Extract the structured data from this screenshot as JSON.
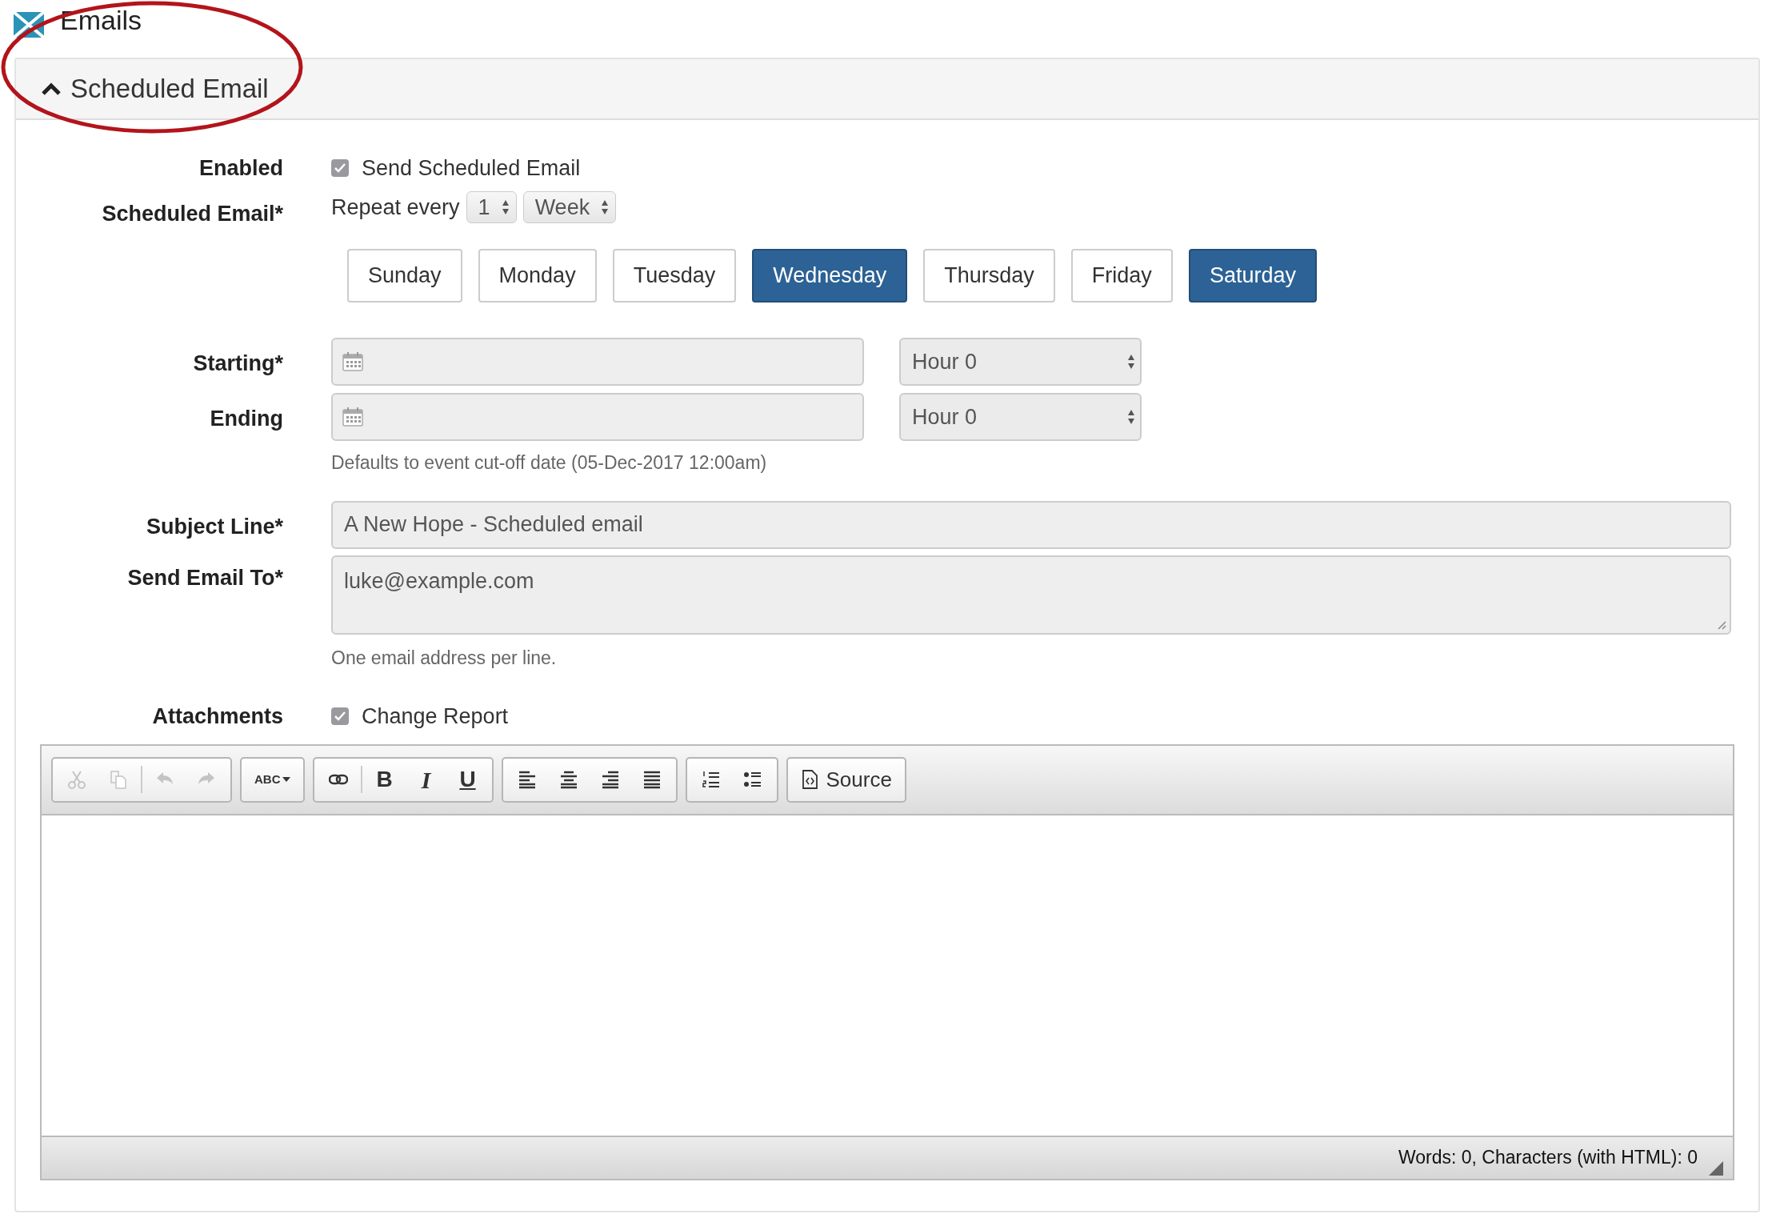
{
  "page": {
    "title": "Emails"
  },
  "panel": {
    "title": "Scheduled Email",
    "expanded": true
  },
  "enabled": {
    "label": "Enabled",
    "option": "Send Scheduled Email",
    "checked": true
  },
  "schedule": {
    "label": "Scheduled Email*",
    "prefix": "Repeat every",
    "interval": "1",
    "unit": "Week",
    "days": [
      {
        "label": "Sunday",
        "selected": false
      },
      {
        "label": "Monday",
        "selected": false
      },
      {
        "label": "Tuesday",
        "selected": false
      },
      {
        "label": "Wednesday",
        "selected": true
      },
      {
        "label": "Thursday",
        "selected": false
      },
      {
        "label": "Friday",
        "selected": false
      },
      {
        "label": "Saturday",
        "selected": true
      }
    ]
  },
  "starting": {
    "label": "Starting*",
    "hour": "Hour 0"
  },
  "ending": {
    "label": "Ending",
    "hour": "Hour 0",
    "help": "Defaults to event cut-off date (05-Dec-2017 12:00am)"
  },
  "subject": {
    "label": "Subject Line*",
    "value": "A New Hope - Scheduled email"
  },
  "send_to": {
    "label": "Send Email To*",
    "value": "luke@example.com",
    "help": "One email address per line."
  },
  "attachments": {
    "label": "Attachments",
    "option": "Change Report",
    "checked": true
  },
  "editor": {
    "toolbar": [
      [
        {
          "kind": "cut",
          "disabled": true
        },
        {
          "kind": "copy",
          "disabled": true
        },
        {
          "kind": "sep"
        },
        {
          "kind": "undo",
          "disabled": true
        },
        {
          "kind": "redo",
          "disabled": true
        }
      ],
      [
        {
          "kind": "spell",
          "label": "ABC",
          "disabled": false
        }
      ],
      [
        {
          "kind": "link",
          "disabled": false
        },
        {
          "kind": "sep"
        },
        {
          "kind": "bold",
          "label": "B",
          "disabled": false
        },
        {
          "kind": "italic",
          "label": "I",
          "disabled": false
        },
        {
          "kind": "underline",
          "label": "U",
          "disabled": false
        }
      ],
      [
        {
          "kind": "align-left",
          "disabled": false
        },
        {
          "kind": "align-center",
          "disabled": false
        },
        {
          "kind": "align-right",
          "disabled": false
        },
        {
          "kind": "justify",
          "disabled": false
        }
      ],
      [
        {
          "kind": "numbered",
          "disabled": false
        },
        {
          "kind": "bulleted",
          "disabled": false
        }
      ],
      [
        {
          "kind": "source",
          "label": "Source",
          "disabled": false
        }
      ]
    ],
    "status": "Words: 0, Characters (with HTML): 0"
  }
}
